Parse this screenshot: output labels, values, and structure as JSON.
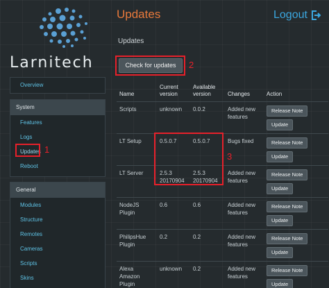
{
  "sidebar": {
    "brand": "Larnitech",
    "overview": "Overview",
    "system_header": "System",
    "system_items": [
      "Features",
      "Logs",
      "Updates",
      "Reboot"
    ],
    "general_header": "General",
    "general_items": [
      "Modules",
      "Structure",
      "Remotes",
      "Cameras",
      "Scripts",
      "Skins"
    ]
  },
  "header": {
    "title": "Updates",
    "logout": "Logout",
    "logout_icon": "logout-icon"
  },
  "main": {
    "subtitle": "Updates",
    "check_button": "Check for updates"
  },
  "table": {
    "headers": [
      "Name",
      "Current version",
      "Available version",
      "Changes",
      "Action"
    ],
    "rows": [
      {
        "name": "Scripts",
        "current": "unknown",
        "available": "0.0.2",
        "changes": "Added new features",
        "actions": [
          "Release Note",
          "Update"
        ]
      },
      {
        "name": "LT Setup",
        "current": "0.5.0.7",
        "available": "0.5.0.7",
        "changes": "Bugs fixed",
        "actions": [
          "Release Note",
          "Update"
        ]
      },
      {
        "name": "LT Server",
        "current": "2.5.3 20170904",
        "available": "2.5.3 20170904",
        "changes": "Added new features",
        "actions": [
          "Release Note",
          "Update"
        ]
      },
      {
        "name": "NodeJS Plugin",
        "current": "0.6",
        "available": "0.6",
        "changes": "Added new features",
        "actions": [
          "Release Note",
          "Update"
        ]
      },
      {
        "name": "PhilipsHue Plugin",
        "current": "0.2",
        "available": "0.2",
        "changes": "Added new features",
        "actions": [
          "Release Note",
          "Update"
        ]
      },
      {
        "name": "Alexa Amazon Plugin",
        "current": "unknown",
        "available": "0.2",
        "changes": "Added new features",
        "actions": [
          "Release Note",
          "Update"
        ]
      }
    ]
  },
  "annotations": [
    "1",
    "2",
    "3"
  ],
  "colors": {
    "accent_orange": "#e8793b",
    "link_blue": "#5fc3e6",
    "annotation_red": "#e8202a"
  }
}
